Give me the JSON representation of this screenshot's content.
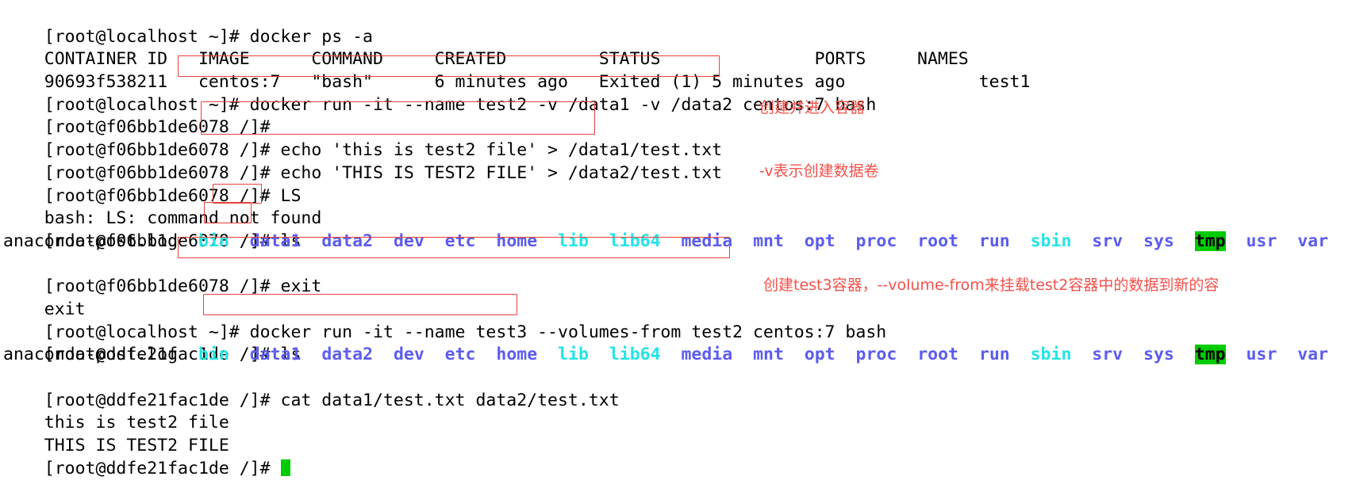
{
  "terminal": {
    "background": "#ffffff",
    "foreground": "#000000",
    "cursor_color": "#00cc00",
    "annotation_color": "#f4504a",
    "box_color": "#e8413a",
    "colors": {
      "symlink_cyan": "#22e5e5",
      "directory_blue": "#5c5cf0",
      "sticky_green_bg": "#00cc00"
    },
    "prompts": {
      "host": "[root@localhost ~]# ",
      "container_test2": "[root@f06bb1de6078 /]# ",
      "container_test3": "[root@ddfe21fac1de /]# "
    },
    "lines": {
      "l01_cmd": "docker ps -a",
      "l02_header": "CONTAINER ID   IMAGE      COMMAND     CREATED         STATUS               PORTS     NAMES",
      "l03_row": "90693f538211   centos:7   \"bash\"      6 minutes ago   Exited (1) 5 minutes ago             test1",
      "l04_cmd": "docker run -it --name test2 -v /data1 -v /data2 centos:7 bash",
      "l05_empty": "",
      "l06_cmd": "echo 'this is test2 file' > /data1/test.txt",
      "l07_cmd": "echo 'THIS IS TEST2 FILE' > /data2/test.txt",
      "l08_cmd": "LS",
      "l09_out": "bash: LS: command not found",
      "l10_cmd": "ls",
      "l12_cmd": "exit",
      "l13_out": "exit",
      "l14_cmd": "docker run -it --name test3 --volumes-from test2 centos:7 bash",
      "l15_cmd": "ls",
      "l17_cmd": "cat data1/test.txt data2/test.txt",
      "l18_out": "this is test2 file",
      "l19_out": "THIS IS TEST2 FILE"
    },
    "ls_output": [
      {
        "name": "anaconda-post.log",
        "type": "plain"
      },
      {
        "name": "bin",
        "type": "link"
      },
      {
        "name": "data1",
        "type": "dir"
      },
      {
        "name": "data2",
        "type": "dir"
      },
      {
        "name": "dev",
        "type": "dir"
      },
      {
        "name": "etc",
        "type": "dir"
      },
      {
        "name": "home",
        "type": "dir"
      },
      {
        "name": "lib",
        "type": "link"
      },
      {
        "name": "lib64",
        "type": "link"
      },
      {
        "name": "media",
        "type": "dir"
      },
      {
        "name": "mnt",
        "type": "dir"
      },
      {
        "name": "opt",
        "type": "dir"
      },
      {
        "name": "proc",
        "type": "dir"
      },
      {
        "name": "root",
        "type": "dir"
      },
      {
        "name": "run",
        "type": "dir"
      },
      {
        "name": "sbin",
        "type": "link"
      },
      {
        "name": "srv",
        "type": "dir"
      },
      {
        "name": "sys",
        "type": "dir"
      },
      {
        "name": "tmp",
        "type": "sticky"
      },
      {
        "name": "usr",
        "type": "dir"
      },
      {
        "name": "var",
        "type": "dir"
      }
    ],
    "annotations": {
      "note1_line1": "创建并进入容器",
      "note1_line2": "-v表示创建数据卷",
      "note2": "创建test3容器，--volume-from来挂载test2容器中的数据到新的容"
    }
  }
}
